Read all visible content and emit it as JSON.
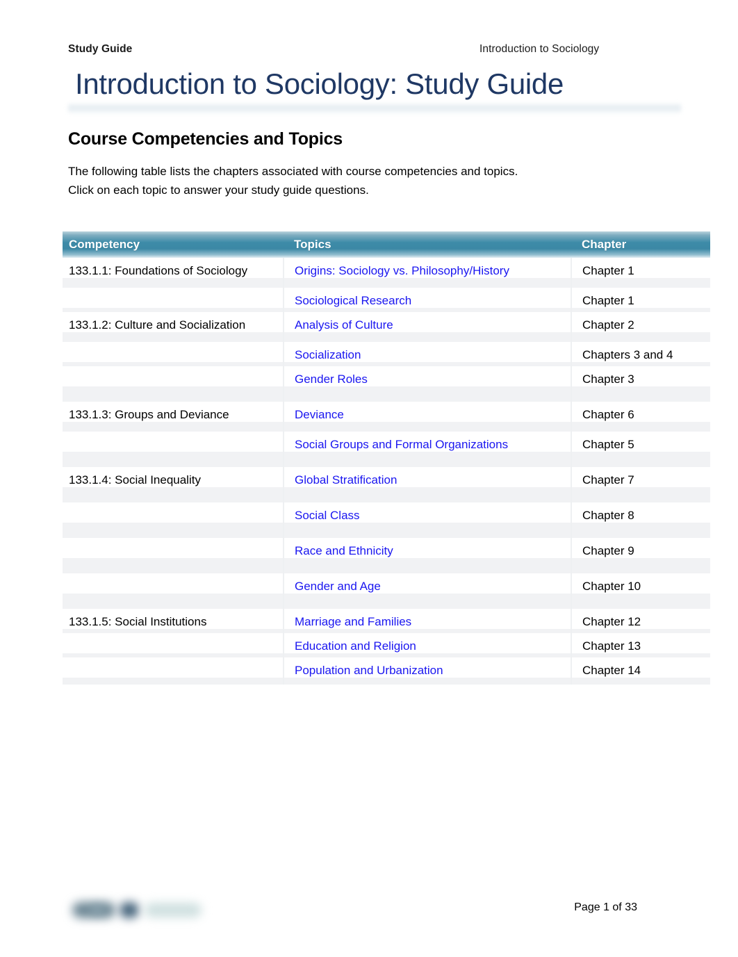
{
  "header": {
    "left_label": "Study Guide",
    "right_label": "Introduction to Sociology"
  },
  "title": "Introduction to Sociology: Study Guide",
  "section": {
    "heading": "Course Competencies and Topics",
    "intro_line_1": "The following table lists the chapters associated with course competencies and topics.",
    "intro_line_2": "Click on each topic to answer your study guide questions."
  },
  "table": {
    "columns": [
      "Competency",
      "Topics",
      "Chapter"
    ],
    "rows": [
      {
        "competency": "133.1.1: Foundations of Sociology",
        "topic": "Origins: Sociology vs. Philosophy/History",
        "chapter": "Chapter 1"
      },
      {
        "competency": "",
        "topic": "Sociological Research",
        "chapter": "Chapter 1"
      },
      {
        "competency": "133.1.2: Culture and Socialization",
        "topic": "Analysis of Culture",
        "chapter": "Chapter 2"
      },
      {
        "competency": "",
        "topic": "Socialization",
        "chapter": "Chapters 3 and 4"
      },
      {
        "competency": "",
        "topic": "Gender Roles",
        "chapter": "Chapter 3"
      },
      {
        "competency": "133.1.3: Groups and Deviance",
        "topic": "Deviance",
        "chapter": "Chapter 6"
      },
      {
        "competency": "",
        "topic": "Social Groups and Formal Organizations",
        "chapter": "Chapter 5"
      },
      {
        "competency": "133.1.4: Social Inequality",
        "topic": "Global Stratification",
        "chapter": "Chapter 7"
      },
      {
        "competency": "",
        "topic": "Social Class",
        "chapter": "Chapter 8"
      },
      {
        "competency": "",
        "topic": "Race and Ethnicity",
        "chapter": "Chapter 9"
      },
      {
        "competency": "",
        "topic": "Gender and Age",
        "chapter": "Chapter 10"
      },
      {
        "competency": "133.1.5: Social Institutions",
        "topic": "Marriage and Families",
        "chapter": "Chapter 12"
      },
      {
        "competency": "",
        "topic": "Education and Religion",
        "chapter": "Chapter 13"
      },
      {
        "competency": "",
        "topic": "Population and Urbanization",
        "chapter": "Chapter 14"
      }
    ]
  },
  "footer": {
    "page_number": "Page 1 of 33"
  },
  "colors": {
    "title": "#1F3864",
    "table_header_teal": "#3D8BA8",
    "link_blue": "#1A16F0",
    "body_text": "#000000"
  }
}
